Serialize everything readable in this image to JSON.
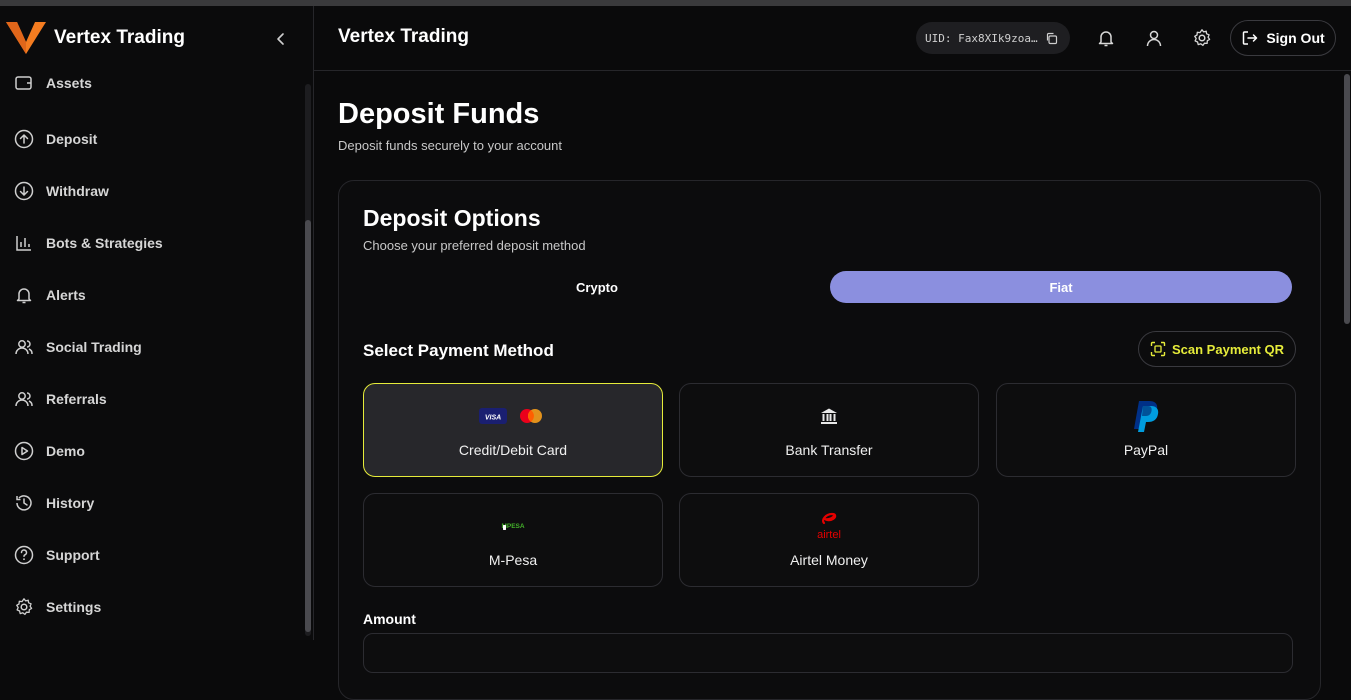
{
  "app": {
    "name": "Vertex Trading",
    "accent": "#f47c20",
    "highlight": "#e6ec3a",
    "tab_active_color": "#8b8fdf"
  },
  "sidebar": {
    "items": [
      {
        "label": "Assets",
        "icon": "wallet-icon"
      },
      {
        "label": "Deposit",
        "icon": "arrow-up-circle-icon"
      },
      {
        "label": "Withdraw",
        "icon": "arrow-down-circle-icon"
      },
      {
        "label": "Bots & Strategies",
        "icon": "bar-chart-icon"
      },
      {
        "label": "Alerts",
        "icon": "bell-icon"
      },
      {
        "label": "Social Trading",
        "icon": "users-icon"
      },
      {
        "label": "Referrals",
        "icon": "users-icon"
      },
      {
        "label": "Demo",
        "icon": "play-circle-icon"
      },
      {
        "label": "History",
        "icon": "history-icon"
      },
      {
        "label": "Support",
        "icon": "help-circle-icon"
      },
      {
        "label": "Settings",
        "icon": "gear-icon"
      }
    ]
  },
  "header": {
    "title": "Vertex Trading",
    "uid": "UID: Fax8XIk9zoa…",
    "sign_out": "Sign Out"
  },
  "page": {
    "title": "Deposit Funds",
    "subtitle": "Deposit funds securely to your account"
  },
  "deposit": {
    "title": "Deposit Options",
    "subtitle": "Choose your preferred deposit method",
    "tabs": [
      {
        "label": "Crypto",
        "active": false
      },
      {
        "label": "Fiat",
        "active": true
      }
    ],
    "section_title": "Select Payment Method",
    "scan_label": "Scan Payment QR",
    "methods": [
      {
        "label": "Credit/Debit Card",
        "icon": "card-brands-icon",
        "selected": true
      },
      {
        "label": "Bank Transfer",
        "icon": "bank-icon",
        "selected": false
      },
      {
        "label": "PayPal",
        "icon": "paypal-icon",
        "selected": false
      },
      {
        "label": "M-Pesa",
        "icon": "mpesa-icon",
        "selected": false
      },
      {
        "label": "Airtel Money",
        "icon": "airtel-icon",
        "selected": false
      }
    ],
    "amount_label": "Amount",
    "visa_text": "VISA",
    "mpesa_text": "MPESA",
    "airtel_text": "airtel"
  }
}
